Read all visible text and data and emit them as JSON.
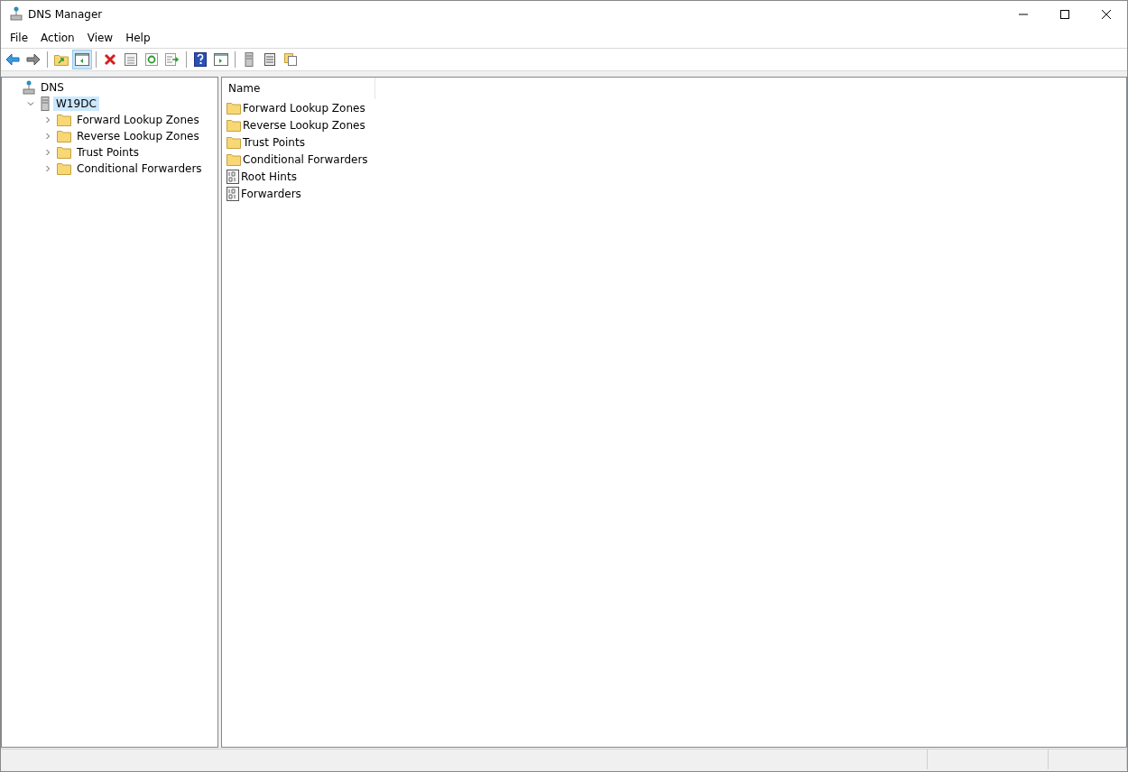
{
  "window": {
    "title": "DNS Manager"
  },
  "menu": [
    "File",
    "Action",
    "View",
    "Help"
  ],
  "toolbar": [
    {
      "kind": "back",
      "pressed": false
    },
    {
      "kind": "forward",
      "pressed": false
    },
    {
      "kind": "sep"
    },
    {
      "kind": "up",
      "pressed": false
    },
    {
      "kind": "tree",
      "pressed": true
    },
    {
      "kind": "sep"
    },
    {
      "kind": "delete",
      "pressed": false
    },
    {
      "kind": "properties",
      "pressed": false
    },
    {
      "kind": "refresh",
      "pressed": false
    },
    {
      "kind": "export",
      "pressed": false
    },
    {
      "kind": "sep"
    },
    {
      "kind": "help",
      "pressed": false
    },
    {
      "kind": "pane",
      "pressed": false
    },
    {
      "kind": "sep"
    },
    {
      "kind": "server",
      "pressed": false
    },
    {
      "kind": "list",
      "pressed": false
    },
    {
      "kind": "copy",
      "pressed": false
    }
  ],
  "tree": [
    {
      "label": "DNS",
      "kind": "dns",
      "selected": false,
      "children": [
        {
          "label": "W19DC",
          "kind": "server",
          "expanded": true,
          "selected": true,
          "children": [
            {
              "label": "Forward Lookup Zones",
              "kind": "folder",
              "expanded": false,
              "selected": false
            },
            {
              "label": "Reverse Lookup Zones",
              "kind": "folder",
              "expanded": false,
              "selected": false
            },
            {
              "label": "Trust Points",
              "kind": "folder",
              "expanded": false,
              "selected": false
            },
            {
              "label": "Conditional Forwarders",
              "kind": "folder",
              "expanded": false,
              "selected": false
            }
          ]
        }
      ]
    }
  ],
  "list": {
    "columns": [
      "Name"
    ],
    "rows": [
      {
        "name": "Forward Lookup Zones",
        "kind": "folder"
      },
      {
        "name": "Reverse Lookup Zones",
        "kind": "folder"
      },
      {
        "name": "Trust Points",
        "kind": "folder"
      },
      {
        "name": "Conditional Forwarders",
        "kind": "folder"
      },
      {
        "name": "Root Hints",
        "kind": "file"
      },
      {
        "name": "Forwarders",
        "kind": "file"
      }
    ]
  }
}
